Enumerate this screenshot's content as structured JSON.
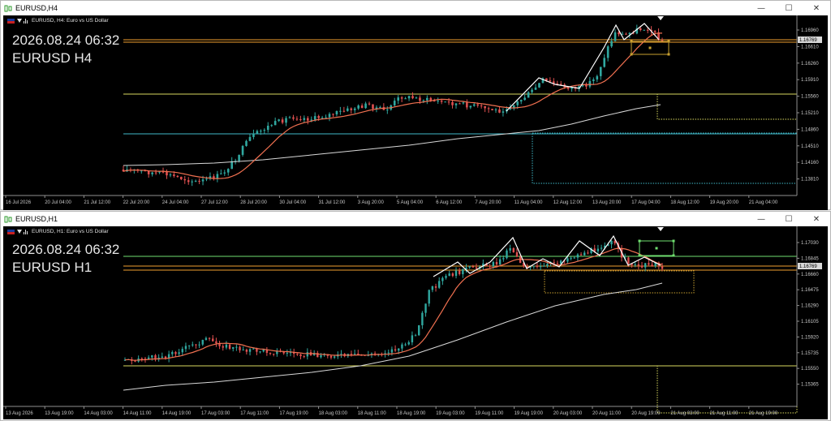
{
  "windows": [
    {
      "title": "EURUSD,H4",
      "symbol_header": "EURUSD, H4:  Euro vs US Dollar",
      "timestamp": "2026.08.24 06:32",
      "symbol_tf": "EURUSD H4",
      "current_price": "1.16769",
      "price_labels": [
        "1.16960",
        "1.16610",
        "1.16260",
        "1.15910",
        "1.15560",
        "1.15210",
        "1.14860",
        "1.14510",
        "1.14160",
        "1.13810"
      ],
      "time_labels": [
        "16 Jul 2026",
        "20 Jul 04:00",
        "21 Jul 12:00",
        "22 Jul 20:00",
        "24 Jul 04:00",
        "27 Jul 12:00",
        "28 Jul 20:00",
        "30 Jul 04:00",
        "31 Jul 12:00",
        "3 Aug 20:00",
        "5 Aug 04:00",
        "6 Aug 12:00",
        "7 Aug 20:00",
        "11 Aug 04:00",
        "12 Aug 12:00",
        "13 Aug 20:00",
        "17 Aug 04:00",
        "18 Aug 12:00",
        "19 Aug 20:00",
        "21 Aug 04:00"
      ],
      "buttons": {
        "minimize": "—",
        "maximize": "☐",
        "close": "✕"
      }
    },
    {
      "title": "EURUSD,H1",
      "symbol_header": "EURUSD, H1:  Euro vs US Dollar",
      "timestamp": "2026.08.24 06:32",
      "symbol_tf": "EURUSD H1",
      "current_price": "1.16769",
      "price_labels": [
        "1.17030",
        "1.16845",
        "1.16660",
        "1.16475",
        "1.16290",
        "1.16105",
        "1.15920",
        "1.15735",
        "1.15550",
        "1.15365"
      ],
      "time_labels": [
        "13 Aug 2026",
        "13 Aug 19:00",
        "14 Aug 03:00",
        "14 Aug 11:00",
        "14 Aug 19:00",
        "17 Aug 03:00",
        "17 Aug 11:00",
        "17 Aug 19:00",
        "18 Aug 03:00",
        "18 Aug 11:00",
        "18 Aug 19:00",
        "19 Aug 03:00",
        "19 Aug 11:00",
        "19 Aug 19:00",
        "20 Aug 03:00",
        "20 Aug 11:00",
        "20 Aug 19:00",
        "21 Aug 03:00",
        "21 Aug 11:00",
        "21 Aug 19:00"
      ],
      "buttons": {
        "minimize": "—",
        "maximize": "☐",
        "close": "✕"
      }
    }
  ],
  "colors": {
    "bull": "#30a8a0",
    "bear": "#e05050",
    "fast_ma": "#f07050",
    "slow_ma": "#d8d8d8",
    "zigzag": "#ffffff",
    "hline_orange": "#f0a030",
    "hline_yellow": "#d8d860",
    "hline_cyan": "#40b8c8",
    "hline_green": "#70e070",
    "box_orange": "#c8a030",
    "box_yellow": "#d8d860",
    "box_cyan": "#40b8c8",
    "box_green": "#70e070"
  }
}
